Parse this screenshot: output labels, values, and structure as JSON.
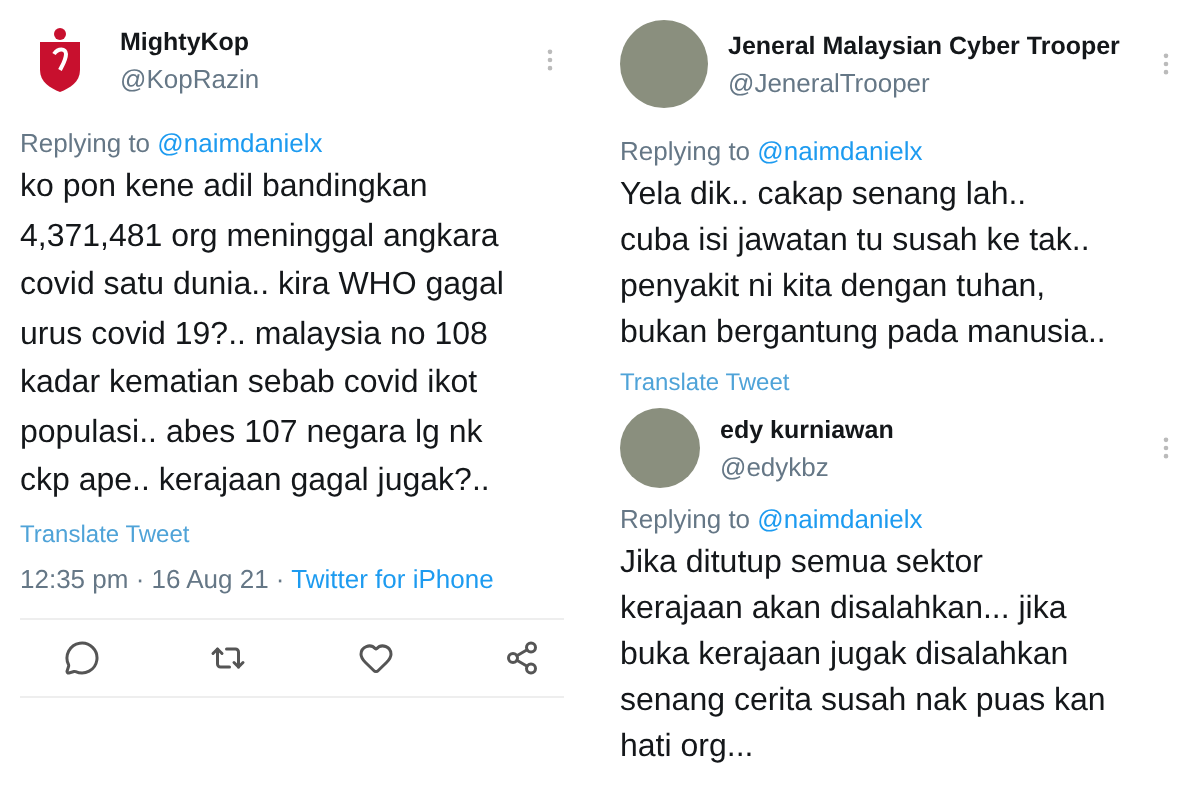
{
  "columns": [
    {
      "tweets": [
        {
          "avatar": {
            "kind": "logo"
          },
          "name": "MightyKop",
          "handle": "@KopRazin",
          "replying_label": "Replying to",
          "replying_to": "@naimdanielx",
          "text": "ko pon kene adil bandingkan\n4,371,481 org meninggal angkara\ncovid satu dunia.. kira WHO gagal\nurus covid 19?.. malaysia no 108\nkadar kematian sebab covid ikot\npopulasi.. abes 107 negara lg nk\nckp ape.. kerajaan gagal jugak?..",
          "translate": "Translate Tweet",
          "time": "12:35 pm · 16 Aug 21 · ",
          "source": "Twitter for iPhone",
          "actions": true
        }
      ]
    },
    {
      "tweets": [
        {
          "avatar": {
            "kind": "photo"
          },
          "name": "Jeneral Malaysian Cyber Trooper",
          "handle": "@JeneralTrooper",
          "replying_label": "Replying to",
          "replying_to": "@naimdanielx",
          "text": "Yela dik.. cakap senang lah..\ncuba isi jawatan tu susah ke tak..\npenyakit ni kita dengan tuhan,\nbukan bergantung pada manusia..",
          "translate": "Translate Tweet",
          "actions": false
        },
        {
          "avatar": {
            "kind": "photo"
          },
          "name": "edy kurniawan",
          "handle": "@edykbz",
          "replying_label": "Replying to",
          "replying_to": "@naimdanielx",
          "text": "Jika ditutup semua sektor\nkerajaan akan disalahkan... jika\nbuka kerajaan jugak disalahkan\nsenang cerita susah nak puas kan\nhati org...",
          "actions": false
        }
      ]
    }
  ]
}
